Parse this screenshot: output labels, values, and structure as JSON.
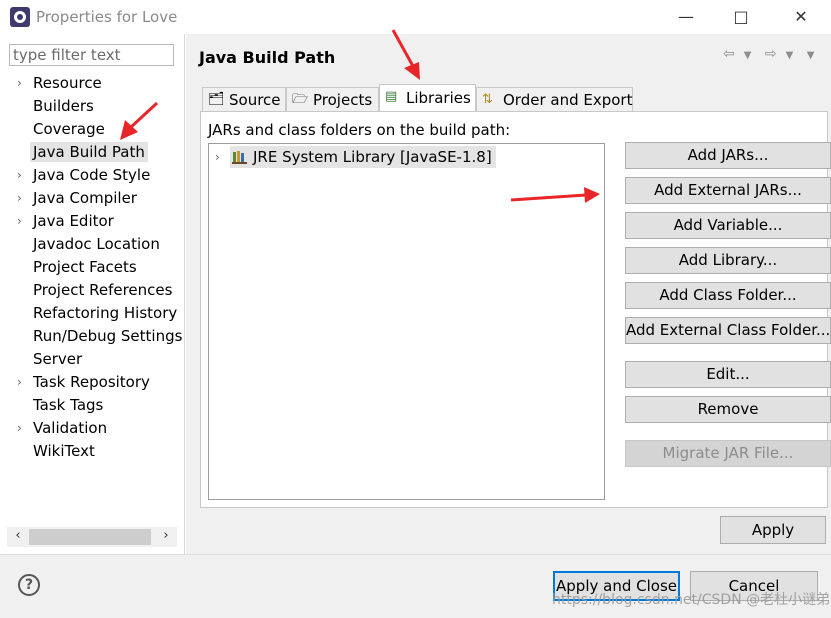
{
  "window": {
    "title": "Properties for Love",
    "controls": [
      "minimize-icon",
      "maximize-icon",
      "close-icon"
    ]
  },
  "sidebar": {
    "filter_placeholder": "type filter text",
    "items": [
      {
        "label": "Resource",
        "expandable": true
      },
      {
        "label": "Builders",
        "expandable": false
      },
      {
        "label": "Coverage",
        "expandable": false
      },
      {
        "label": "Java Build Path",
        "expandable": false,
        "selected": true
      },
      {
        "label": "Java Code Style",
        "expandable": true
      },
      {
        "label": "Java Compiler",
        "expandable": true
      },
      {
        "label": "Java Editor",
        "expandable": true
      },
      {
        "label": "Javadoc Location",
        "expandable": false
      },
      {
        "label": "Project Facets",
        "expandable": false
      },
      {
        "label": "Project References",
        "expandable": false
      },
      {
        "label": "Refactoring History",
        "expandable": false
      },
      {
        "label": "Run/Debug Settings",
        "expandable": false
      },
      {
        "label": "Server",
        "expandable": false
      },
      {
        "label": "Task Repository",
        "expandable": true
      },
      {
        "label": "Task Tags",
        "expandable": false
      },
      {
        "label": "Validation",
        "expandable": true
      },
      {
        "label": "WikiText",
        "expandable": false
      }
    ]
  },
  "main": {
    "title": "Java Build Path",
    "tabs": [
      {
        "label": "Source",
        "icon": "source-folder-icon"
      },
      {
        "label": "Projects",
        "icon": "projects-folder-icon"
      },
      {
        "label": "Libraries",
        "icon": "libraries-icon",
        "active": true
      },
      {
        "label": "Order and Export",
        "icon": "order-export-icon"
      }
    ],
    "panel_label": "JARs and class folders on the build path:",
    "libraries": [
      {
        "label": "JRE System Library [JavaSE-1.8]"
      }
    ],
    "buttons": [
      {
        "label": "Add JARs...",
        "enabled": true
      },
      {
        "label": "Add External JARs...",
        "enabled": true
      },
      {
        "label": "Add Variable...",
        "enabled": true
      },
      {
        "label": "Add Library...",
        "enabled": true
      },
      {
        "label": "Add Class Folder...",
        "enabled": true
      },
      {
        "label": "Add External Class Folder...",
        "enabled": true
      },
      {
        "label": "Edit...",
        "enabled": true
      },
      {
        "label": "Remove",
        "enabled": true
      },
      {
        "label": "Migrate JAR File...",
        "enabled": false
      }
    ],
    "apply_label": "Apply"
  },
  "footer": {
    "apply_close_label": "Apply and Close",
    "cancel_label": "Cancel"
  },
  "watermark": "https://blog.csdn.net/CSDN @老杜小谜弟",
  "colors": {
    "annotation_arrow": "#e8262a",
    "default_button_border": "#0078d7"
  }
}
